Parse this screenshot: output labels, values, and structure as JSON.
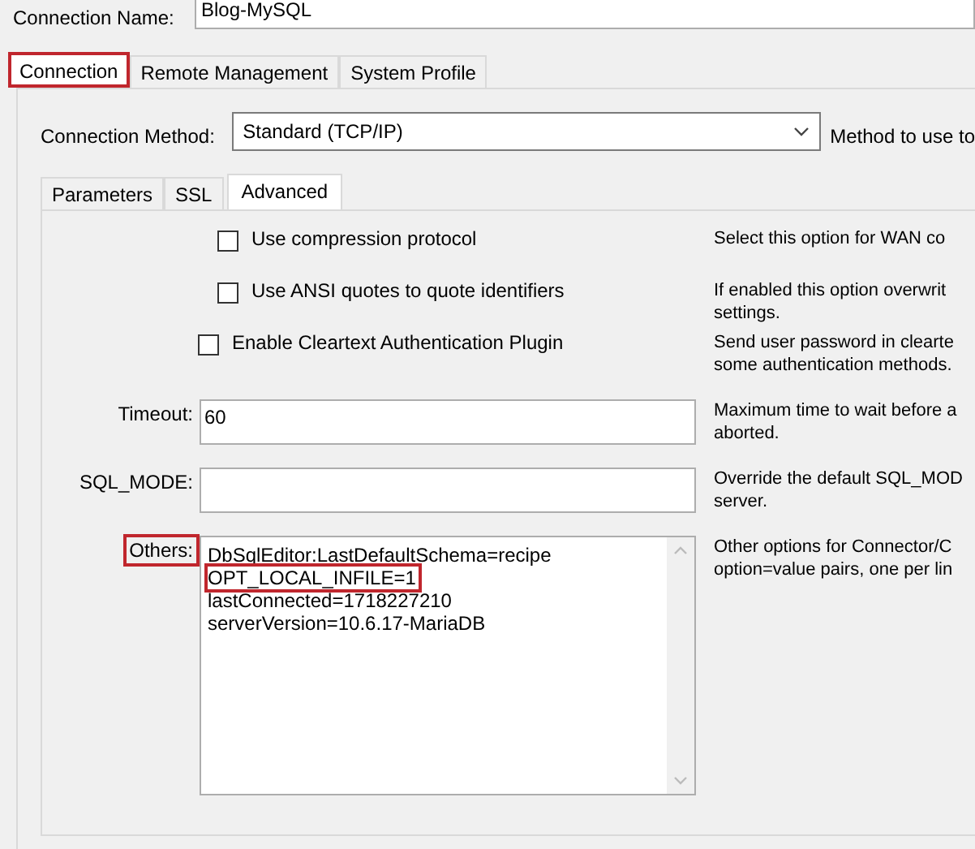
{
  "connection_name": {
    "label": "Connection Name:",
    "value": "Blog-MySQL"
  },
  "tabs": [
    {
      "label": "Connection",
      "selected": true,
      "highlighted": true
    },
    {
      "label": "Remote Management",
      "selected": false,
      "highlighted": false
    },
    {
      "label": "System Profile",
      "selected": false,
      "highlighted": false
    }
  ],
  "connection_method": {
    "label": "Connection Method:",
    "value": "Standard (TCP/IP)",
    "description": "Method to use to"
  },
  "inner_tabs": [
    {
      "label": "Parameters",
      "selected": false
    },
    {
      "label": "SSL",
      "selected": false
    },
    {
      "label": "Advanced",
      "selected": true
    }
  ],
  "checkboxes": [
    {
      "label": "Use compression protocol",
      "checked": false,
      "description": [
        "Select this option for WAN co"
      ]
    },
    {
      "label": "Use ANSI quotes to quote identifiers",
      "checked": false,
      "description": [
        "If enabled this option overwrit",
        "settings."
      ]
    },
    {
      "label": "Enable Cleartext Authentication Plugin",
      "checked": false,
      "description": [
        "Send user password in clearte",
        "some authentication methods."
      ]
    }
  ],
  "fields": [
    {
      "kind": "single",
      "label": "Timeout:",
      "highlighted": false,
      "value": "60",
      "description": [
        "Maximum time to wait before a",
        "aborted."
      ]
    },
    {
      "kind": "single",
      "label": "SQL_MODE:",
      "highlighted": false,
      "description": [
        "Override the default SQL_MOD",
        "server."
      ]
    },
    {
      "kind": "multi",
      "label": "Others:",
      "highlighted": true,
      "lines": [
        {
          "text": "DbSqlEditor:LastDefaultSchema=recipe",
          "highlighted": false
        },
        {
          "text": "OPT_LOCAL_INFILE=1",
          "highlighted": true
        },
        {
          "text": "lastConnected=1718227210",
          "highlighted": false
        },
        {
          "text": "serverVersion=10.6.17-MariaDB",
          "highlighted": false
        }
      ],
      "description": [
        "Other options for Connector/C",
        "option=value pairs, one per lin"
      ]
    }
  ]
}
